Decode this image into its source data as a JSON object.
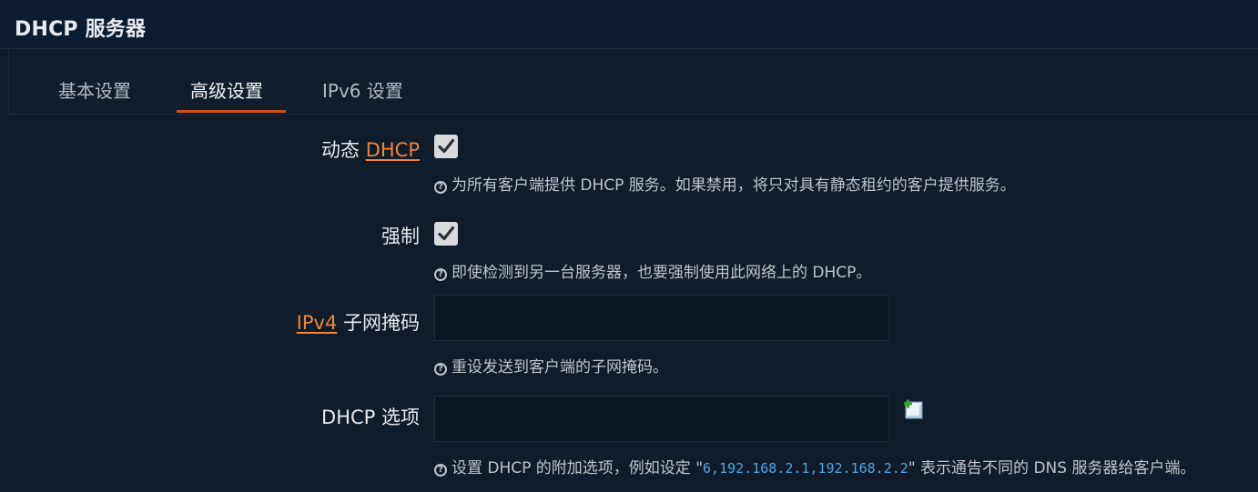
{
  "section": {
    "title": "DHCP 服务器"
  },
  "tabs": [
    {
      "label": "基本设置",
      "active": false
    },
    {
      "label": "高级设置",
      "active": true
    },
    {
      "label": "IPv6 设置",
      "active": false
    }
  ],
  "fields": {
    "dynamic_dhcp": {
      "label_prefix": "动态 ",
      "label_abbr": "DHCP",
      "checked": true,
      "help": "为所有客户端提供 DHCP 服务。如果禁用，将只对具有静态租约的客户提供服务。"
    },
    "force": {
      "label": "强制",
      "checked": true,
      "help": "即使检测到另一台服务器，也要强制使用此网络上的 DHCP。"
    },
    "netmask": {
      "label_abbr": "IPv4",
      "label_suffix": " 子网掩码",
      "value": "",
      "help": "重设发送到客户端的子网掩码。"
    },
    "dhcp_options": {
      "label": "DHCP 选项",
      "value": "",
      "help_before": "设置 DHCP 的附加选项，例如设定 \"",
      "help_code": "6,192.168.2.1,192.168.2.2",
      "help_after": "\" 表示通告不同的 DNS 服务器给客户端。"
    }
  },
  "icons": {
    "help": "question-circle-icon",
    "add": "add-entry-icon",
    "check": "checkmark-icon"
  },
  "colors": {
    "accent": "#f0843c",
    "tab_underline": "#c9501e",
    "code": "#4da6e8",
    "background": "#101c29"
  }
}
